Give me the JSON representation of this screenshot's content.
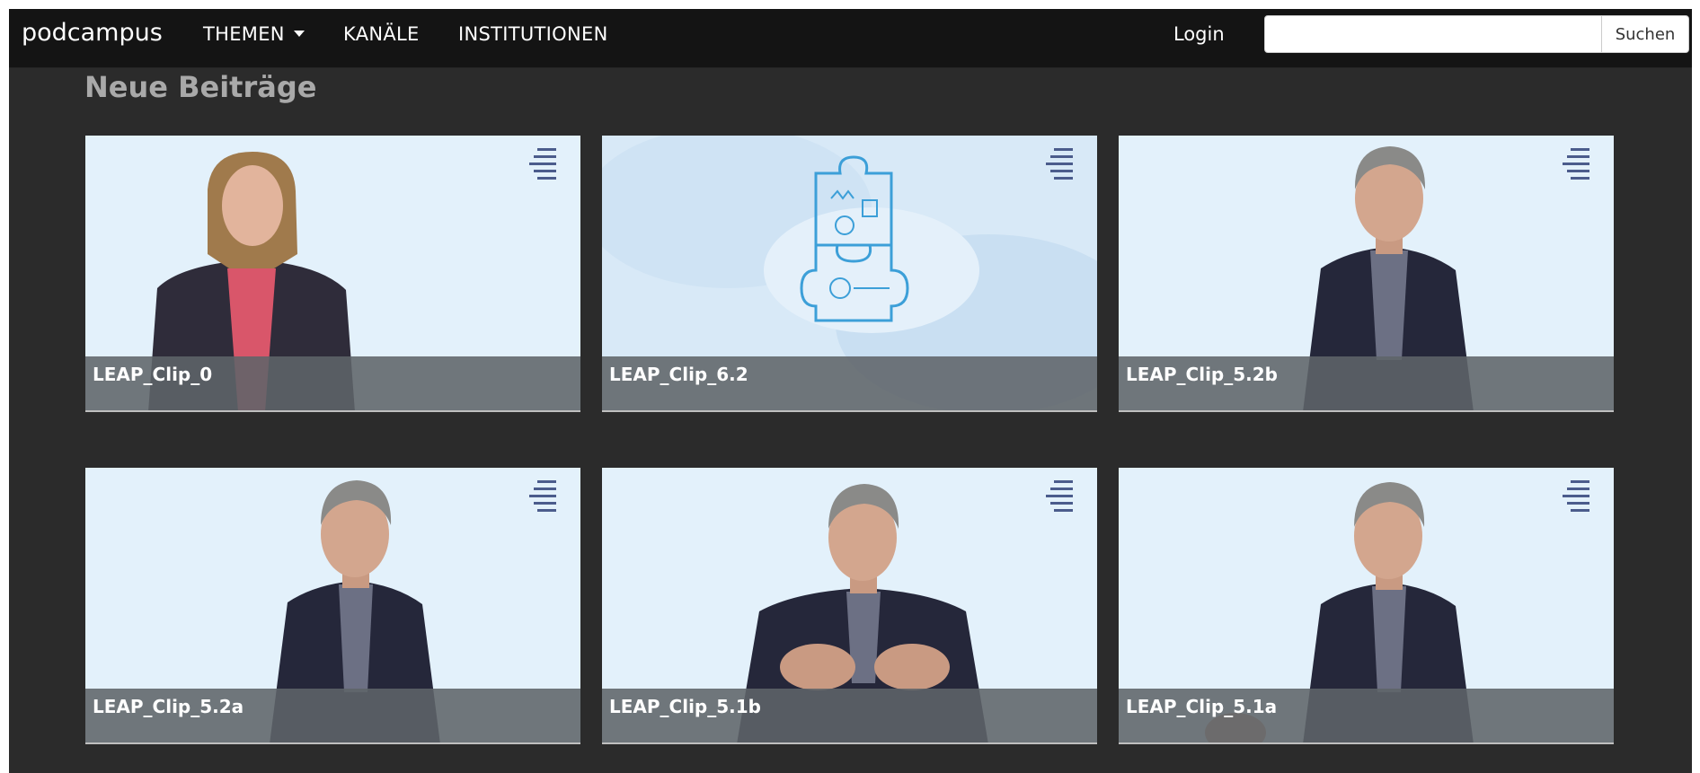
{
  "brand": "podcampus",
  "nav": {
    "themen": "THEMEN",
    "kanaele": "KANÄLE",
    "institutionen": "INSTITUTIONEN",
    "login": "Login"
  },
  "search": {
    "placeholder": "",
    "value": "",
    "button": "Suchen"
  },
  "section_title": "Neue Beiträge",
  "videos": [
    {
      "title": "LEAP_Clip_0"
    },
    {
      "title": "LEAP_Clip_6.2"
    },
    {
      "title": "LEAP_Clip_5.2b"
    },
    {
      "title": "LEAP_Clip_5.2a"
    },
    {
      "title": "LEAP_Clip_5.1b"
    },
    {
      "title": "LEAP_Clip_5.1a"
    }
  ],
  "colors": {
    "navbar": "#141414",
    "background": "#2b2b2b",
    "thumbnail_bg": "#e2f0fb",
    "heading": "#a9a9a9",
    "caption_bar": "#5f6469"
  }
}
